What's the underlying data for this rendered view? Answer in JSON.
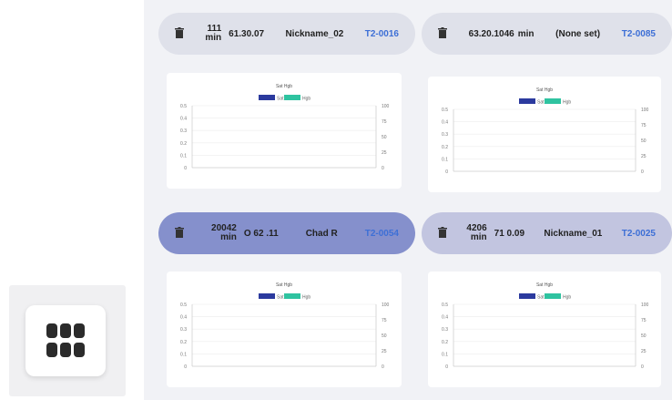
{
  "devices": [
    {
      "id": "T2-0016",
      "name": "Nickname_02",
      "time_value": "111",
      "time_extra": "61.30.07",
      "time_unit": "min",
      "header_color": "#dfe1ea"
    },
    {
      "id": "T2-0085",
      "name": "(None set)",
      "time_value": "",
      "time_extra": "63.20.1046",
      "time_unit": "min",
      "header_color": "#dfe1ea"
    },
    {
      "id": "T2-0054",
      "name": "Chad R",
      "time_value": "20042",
      "time_extra": "O  62  .11",
      "time_unit": "min",
      "header_color": "#8590cc"
    },
    {
      "id": "T2-0025",
      "name": "Nickname_01",
      "time_value": "4206",
      "time_extra": "71  0.09",
      "time_unit": "min",
      "header_color": "#c2c5e0"
    }
  ],
  "chart_data": [
    {
      "type": "line",
      "title": "Sat  Hgb",
      "legend": [
        "Sat",
        "Hgb"
      ],
      "legend_colors": [
        "#2b3a9e",
        "#2fc3a0"
      ],
      "y_left_ticks": [
        "0.5",
        "0.4",
        "0.3",
        "0.2",
        "0.1",
        "0"
      ],
      "y_right_ticks": [
        "100",
        "75",
        "50",
        "25",
        "0"
      ],
      "series": []
    },
    {
      "type": "line",
      "title": "Sat  Hgb",
      "legend": [
        "Sat",
        "Hgb"
      ],
      "legend_colors": [
        "#2b3a9e",
        "#2fc3a0"
      ],
      "y_left_ticks": [
        "0.5",
        "0.4",
        "0.3",
        "0.2",
        "0.1",
        "0"
      ],
      "y_right_ticks": [
        "100",
        "75",
        "50",
        "25",
        "0"
      ],
      "series": []
    },
    {
      "type": "line",
      "title": "Sat  Hgb",
      "legend": [
        "Sat",
        "Hgb"
      ],
      "legend_colors": [
        "#2b3a9e",
        "#2fc3a0"
      ],
      "y_left_ticks": [
        "0.5",
        "0.4",
        "0.3",
        "0.2",
        "0.1",
        "0"
      ],
      "y_right_ticks": [
        "100",
        "75",
        "50",
        "25",
        "0"
      ],
      "series": []
    },
    {
      "type": "line",
      "title": "Sat  Hgb",
      "legend": [
        "Sat",
        "Hgb"
      ],
      "legend_colors": [
        "#2b3a9e",
        "#2fc3a0"
      ],
      "y_left_ticks": [
        "0.5",
        "0.4",
        "0.3",
        "0.2",
        "0.1",
        "0"
      ],
      "y_right_ticks": [
        "100",
        "75",
        "50",
        "25",
        "0"
      ],
      "series": []
    }
  ],
  "icons": {
    "menu": "grid-icon",
    "delete": "trash-icon"
  }
}
